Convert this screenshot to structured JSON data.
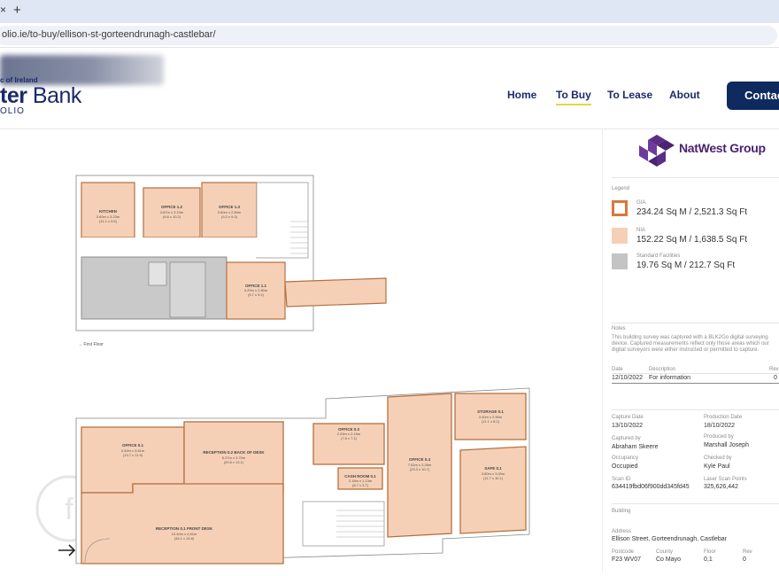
{
  "browser": {
    "new_tab": "+",
    "url": "olio.ie/to-buy/ellison-st-gorteendrunagh-castlebar/"
  },
  "header": {
    "logo_sub": "c of Ireland",
    "logo_main_bold": "ter",
    "logo_main": " Bank",
    "logo_foot": "OLIO",
    "nav": [
      {
        "label": "Home"
      },
      {
        "label": "To Buy"
      },
      {
        "label": "To Lease"
      },
      {
        "label": "About"
      }
    ],
    "contact_label": "Contac",
    "accent": "#1b2a6b",
    "contact_bg": "#0f2a5e",
    "active_underline": "#e3d54a"
  },
  "floorplan": {
    "first_floor_label": "First Floor",
    "rooms_first": [
      {
        "name": "KITCHEN",
        "dims": "3.60m x 3.23m",
        "area": "(11.1 x 9.5)"
      },
      {
        "name": "OFFICE 1.2",
        "dims": "3.87m x 3.10m",
        "area": "(9.8 x 10.2)"
      },
      {
        "name": "OFFICE 1.3",
        "dims": "3.60m x 2.84m",
        "area": "(9.2 x 9.3)"
      },
      {
        "name": "OFFICE 1.1",
        "dims": "3.20m x 2.80m",
        "area": "(9.7 x 9.2)"
      }
    ],
    "rooms_ground": [
      {
        "name": "OFFICE 0.1",
        "dims": "4.40m x 3.61m",
        "area": "(13.7 x 11.9)"
      },
      {
        "name": "RECEPTION 0.2 BACK OF DESK",
        "dims": "6.27m x 3.70m",
        "area": "(20.6 x 12.1)"
      },
      {
        "name": "RECEPTION 0.1 FRONT DESK",
        "dims": "10.40m x 4.81m",
        "area": "(34.1 x 15.8)"
      },
      {
        "name": "OFFICE 0.3",
        "dims": "2.33m x 2.15m",
        "area": "(7.6 x 7.1)"
      },
      {
        "name": "CASH ROOM 0.1",
        "dims": "2.15m x 1.13m",
        "area": "(6.7 x 3.7)"
      },
      {
        "name": "OFFICE 0.4",
        "dims": "7.61m x 3.26m",
        "area": "(23.3 x 10.7)"
      },
      {
        "name": "STORAGE 0.1",
        "dims": "3.40m x 2.50m",
        "area": "(11.1 x 8.2)"
      },
      {
        "name": "SAFE 0.1",
        "dims": "3.80m x 3.00m",
        "area": "(11.7 x 10.1)"
      }
    ],
    "fill_color": "#f6d0b6",
    "outline_color": "#b5703f",
    "grey_color": "#c9c9c9"
  },
  "panel": {
    "brand": "NatWest Group",
    "brand_color": "#4a2371",
    "legend_label": "Legend",
    "legend": [
      {
        "tag": "GIA",
        "value": "234.24 Sq M / 2,521.3 Sq Ft",
        "color": "#d9773c"
      },
      {
        "tag": "NIA",
        "value": "152.22 Sq M / 1,638.5 Sq Ft",
        "color": "#f6d0b6"
      },
      {
        "tag": "Standard Facilities",
        "value": "19.76 Sq M / 212.7 Sq Ft",
        "color": "#c4c4c4"
      }
    ],
    "notes_label": "Notes",
    "notes_text": "This building survey was captured with a BLK2Go digital surveying device. Captured measurements reflect only those areas which our digital surveyors were either instructed or permitted to capture.",
    "table_headers": {
      "date": "Date",
      "description": "Description",
      "rev": "Rev"
    },
    "table_row": {
      "date": "12/10/2022",
      "description": "For information",
      "rev": "0"
    },
    "capture_date_label": "Capture Date",
    "capture_date": "13/10/2022",
    "production_date_label": "Production Date",
    "production_date": "18/10/2022",
    "captured_by_label": "Captured by",
    "captured_by": "Abraham Skeere",
    "produced_by_label": "Produced by",
    "produced_by": "Marshall Joseph",
    "occupancy_label": "Occupancy",
    "occupancy": "Occupied",
    "checked_by_label": "Checked by",
    "checked_by": "Kyle Paul",
    "scan_id_label": "Scan ID",
    "scan_id": "634419fbd06f900dd345fd45",
    "laser_label": "Laser Scan Points",
    "laser_points": "325,626,442",
    "building_label": "Building",
    "address_label": "Address",
    "address": "Ellison Street, Gorteendrunagh, Castlebar",
    "postcode_label": "Postcode",
    "postcode": "F23 WV07",
    "county_label": "County",
    "county": "Co Mayo",
    "floor_label": "Floor",
    "floor": "0,1",
    "rev_label": "Rev",
    "rev": "0"
  }
}
